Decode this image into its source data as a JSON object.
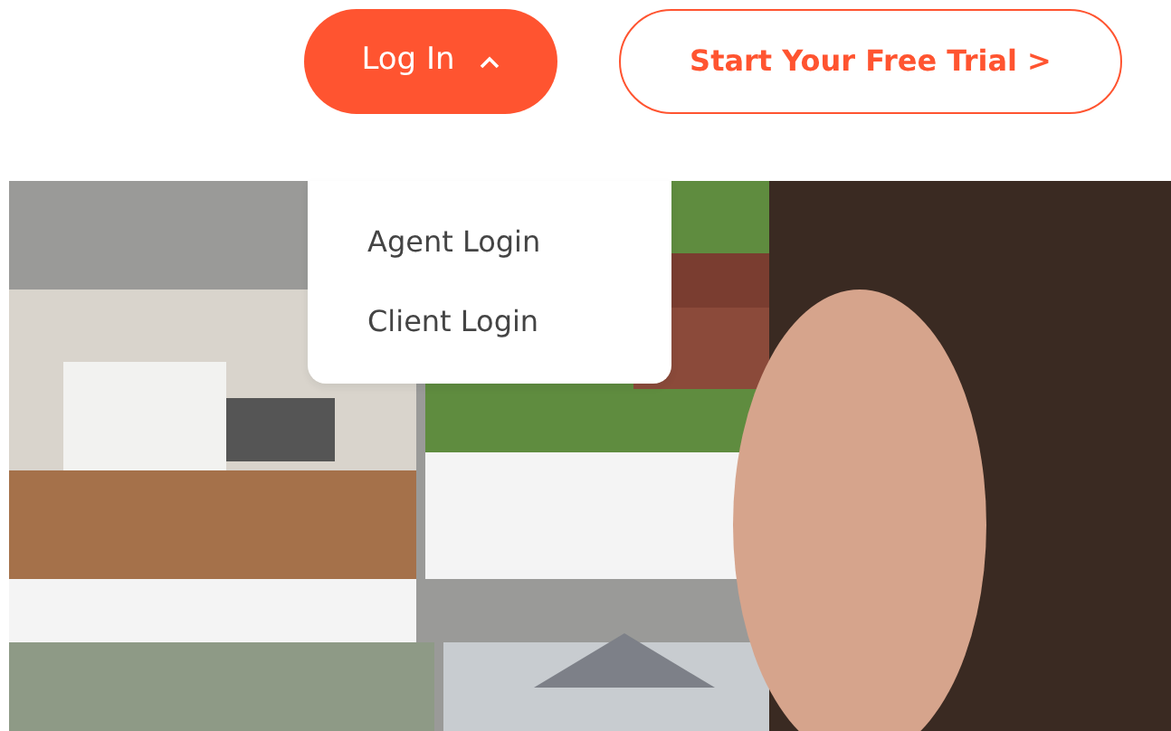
{
  "login_button": {
    "label": "Log In",
    "expanded": true
  },
  "trial_button": {
    "label": "Start Your Free Trial >"
  },
  "login_menu": {
    "items": [
      {
        "label": "Agent Login"
      },
      {
        "label": "Client Login"
      }
    ]
  }
}
